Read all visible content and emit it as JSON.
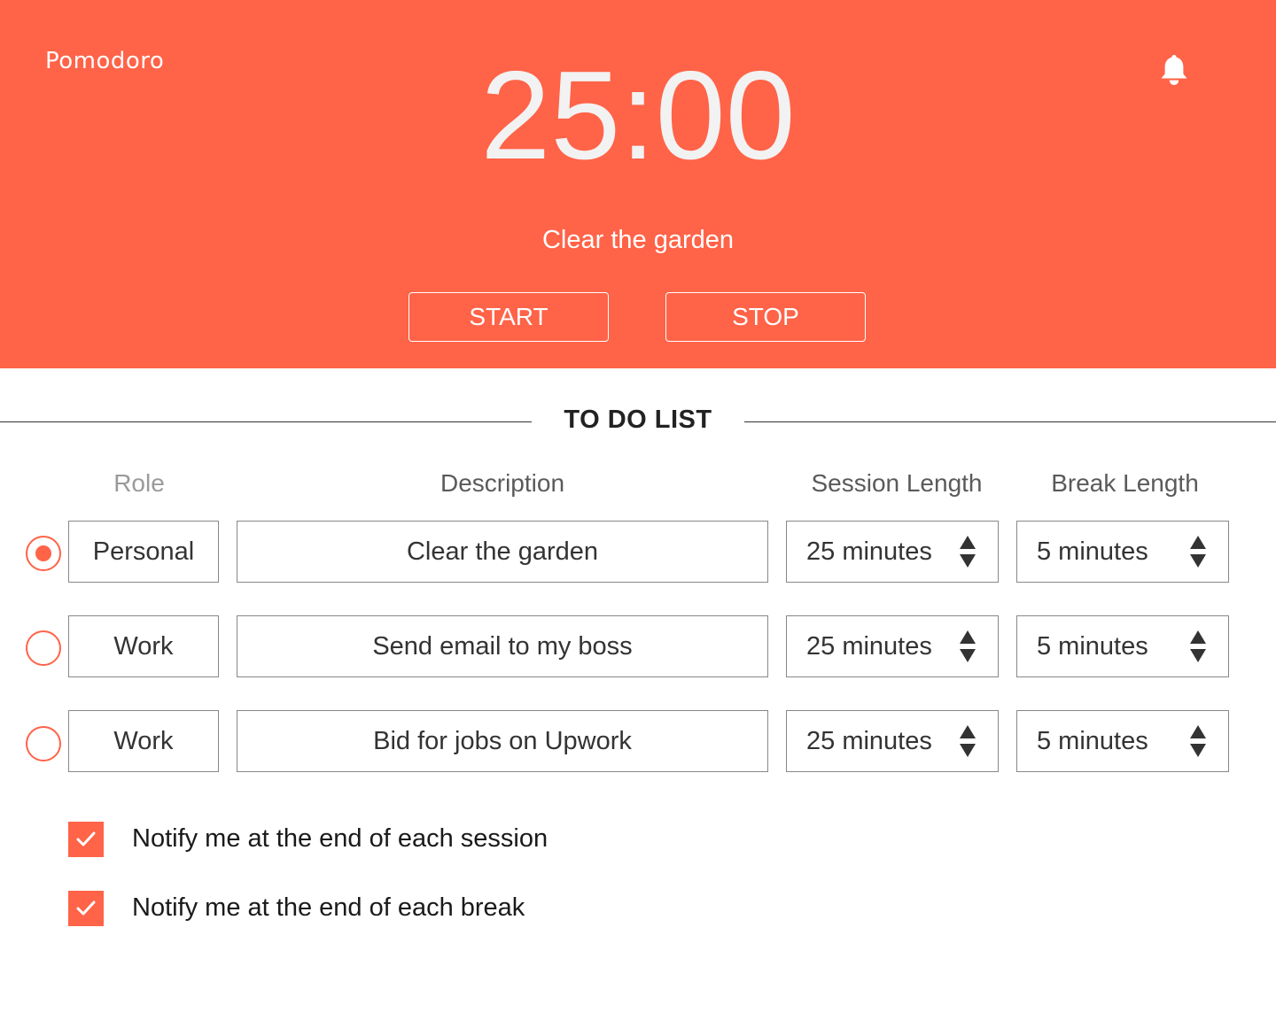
{
  "header": {
    "brand": "Pomodoro",
    "timer": "25:00",
    "current_task": "Clear the garden",
    "start_label": "START",
    "stop_label": "STOP",
    "bell_icon": "bell-icon"
  },
  "todo": {
    "title": "TO DO LIST",
    "columns": {
      "role": "Role",
      "description": "Description",
      "session": "Session Length",
      "break": "Break Length"
    },
    "rows": [
      {
        "selected": true,
        "role": "Personal",
        "description": "Clear the garden",
        "session": "25 minutes",
        "break": "5 minutes"
      },
      {
        "selected": false,
        "role": "Work",
        "description": "Send email to my boss",
        "session": "25 minutes",
        "break": "5 minutes"
      },
      {
        "selected": false,
        "role": "Work",
        "description": "Bid for jobs on Upwork",
        "session": "25 minutes",
        "break": "5 minutes"
      }
    ]
  },
  "options": [
    {
      "checked": true,
      "label": "Notify me at the end of each session"
    },
    {
      "checked": true,
      "label": "Notify me at the end of each break"
    }
  ],
  "colors": {
    "accent": "#ff6348",
    "timer_text": "#f2f2f2",
    "border": "#888888"
  }
}
